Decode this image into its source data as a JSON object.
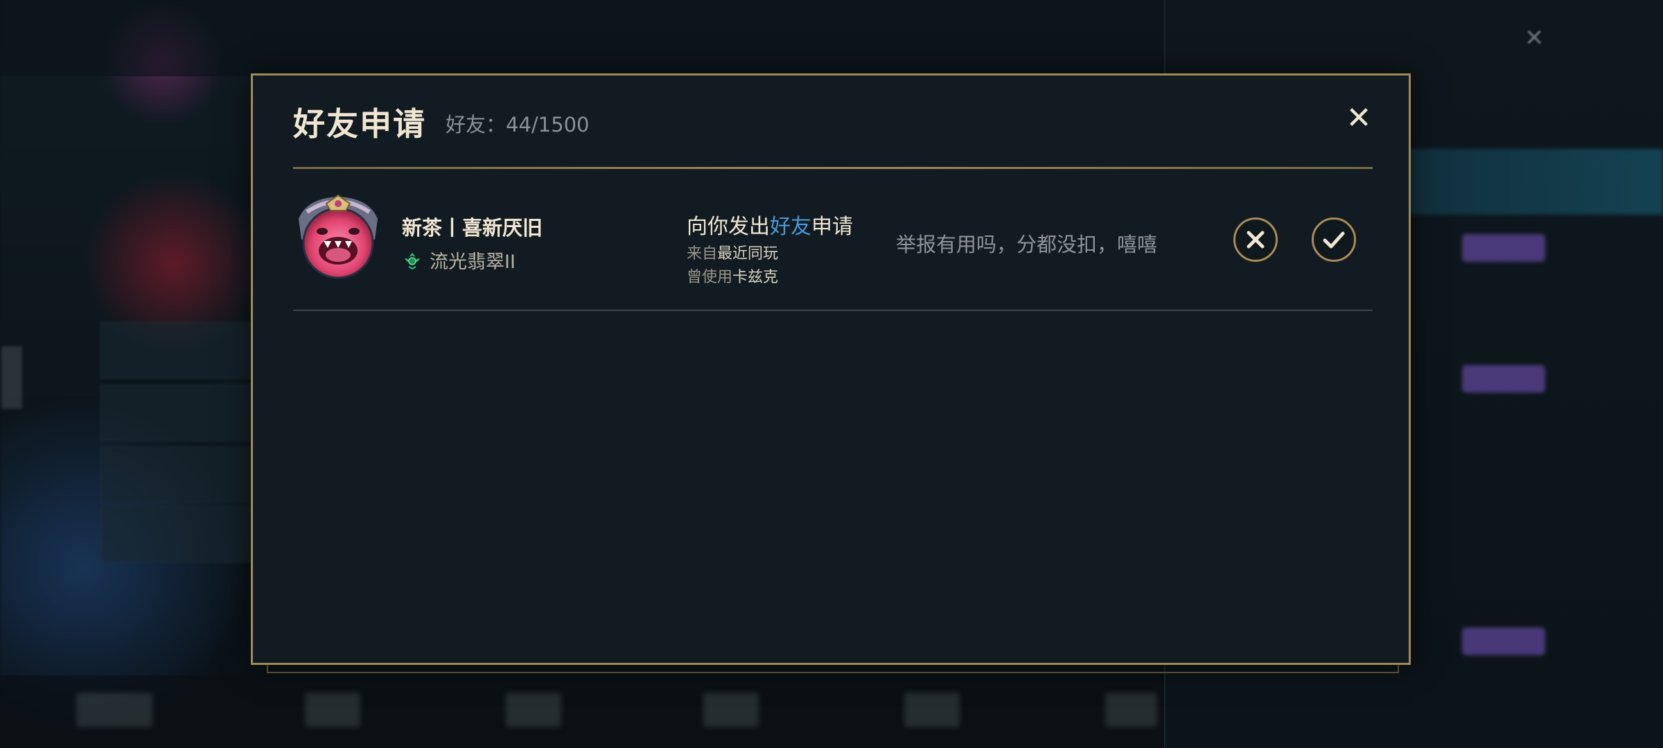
{
  "dialog": {
    "title": "好友申请",
    "friend_count": "好友：44/1500",
    "close_icon": "close-icon"
  },
  "requests": [
    {
      "avatar": "poro-avatar",
      "player_name": "新茶丨喜新厌旧",
      "rank_icon": "emerald-rank-icon",
      "rank": "流光翡翠II",
      "request_text_prefix": "向你发出",
      "request_text_highlight": "好友",
      "request_text_suffix": "申请",
      "source_prefix": "来自",
      "source_value": "最近同玩",
      "champion_prefix": "曾使用",
      "champion_value": "卡兹克",
      "message": "举报有用吗，分都没扣，嘻嘻",
      "decline_icon": "decline-x-icon",
      "accept_icon": "accept-check-icon"
    }
  ],
  "colors": {
    "gold_border": "#a08a57",
    "highlight_blue": "#4a9ad8",
    "panel_bg": "#121b21",
    "rank_green": "#2fbf6f"
  }
}
